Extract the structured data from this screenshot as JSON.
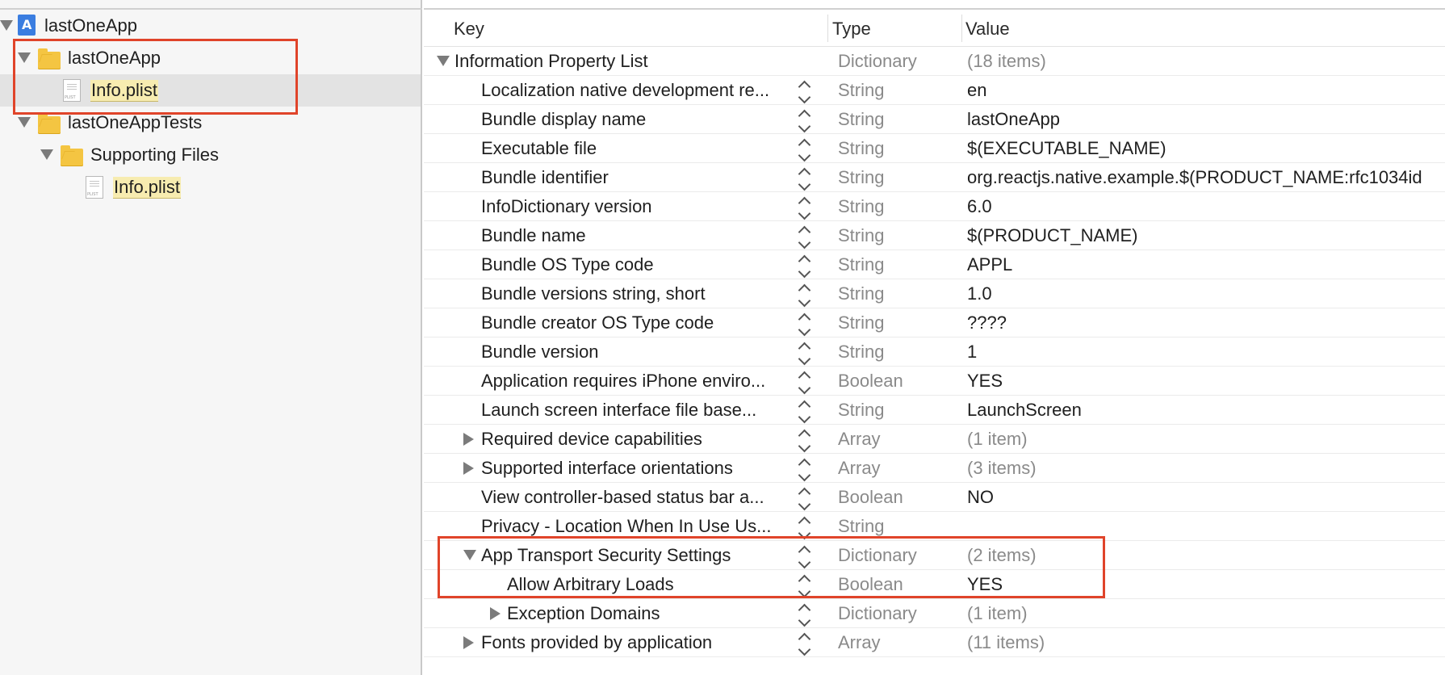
{
  "navigator": {
    "items": [
      {
        "label": "lastOneApp",
        "icon": "xcodeproj-icon",
        "expanded": true
      },
      {
        "label": "lastOneApp",
        "icon": "folder-icon",
        "expanded": true
      },
      {
        "label": "Info.plist",
        "icon": "plist-file-icon"
      },
      {
        "label": "lastOneAppTests",
        "icon": "folder-icon",
        "expanded": true
      },
      {
        "label": "Supporting Files",
        "icon": "folder-icon",
        "expanded": true
      },
      {
        "label": "Info.plist",
        "icon": "plist-file-icon"
      }
    ]
  },
  "editor": {
    "columns": {
      "key": "Key",
      "type": "Type",
      "value": "Value"
    },
    "rows": [
      {
        "key": "Information Property List",
        "type": "Dictionary",
        "value": "(18 items)"
      },
      {
        "key": "Localization native development re...",
        "type": "String",
        "value": "en"
      },
      {
        "key": "Bundle display name",
        "type": "String",
        "value": "lastOneApp"
      },
      {
        "key": "Executable file",
        "type": "String",
        "value": "$(EXECUTABLE_NAME)"
      },
      {
        "key": "Bundle identifier",
        "type": "String",
        "value": "org.reactjs.native.example.$(PRODUCT_NAME:rfc1034id"
      },
      {
        "key": "InfoDictionary version",
        "type": "String",
        "value": "6.0"
      },
      {
        "key": "Bundle name",
        "type": "String",
        "value": "$(PRODUCT_NAME)"
      },
      {
        "key": "Bundle OS Type code",
        "type": "String",
        "value": "APPL"
      },
      {
        "key": "Bundle versions string, short",
        "type": "String",
        "value": "1.0"
      },
      {
        "key": "Bundle creator OS Type code",
        "type": "String",
        "value": "????"
      },
      {
        "key": "Bundle version",
        "type": "String",
        "value": "1"
      },
      {
        "key": "Application requires iPhone enviro...",
        "type": "Boolean",
        "value": "YES"
      },
      {
        "key": "Launch screen interface file base...",
        "type": "String",
        "value": "LaunchScreen"
      },
      {
        "key": "Required device capabilities",
        "type": "Array",
        "value": "(1 item)"
      },
      {
        "key": "Supported interface orientations",
        "type": "Array",
        "value": "(3 items)"
      },
      {
        "key": "View controller-based status bar a...",
        "type": "Boolean",
        "value": "NO"
      },
      {
        "key": "Privacy - Location When In Use Us...",
        "type": "String",
        "value": ""
      },
      {
        "key": "App Transport Security Settings",
        "type": "Dictionary",
        "value": "(2 items)"
      },
      {
        "key": "Allow Arbitrary Loads",
        "type": "Boolean",
        "value": "YES"
      },
      {
        "key": "Exception Domains",
        "type": "Dictionary",
        "value": "(1 item)"
      },
      {
        "key": "Fonts provided by application",
        "type": "Array",
        "value": "(11 items)"
      }
    ]
  },
  "colors": {
    "annotation": "#e0442a",
    "file_highlight": "#f7ecb0"
  }
}
